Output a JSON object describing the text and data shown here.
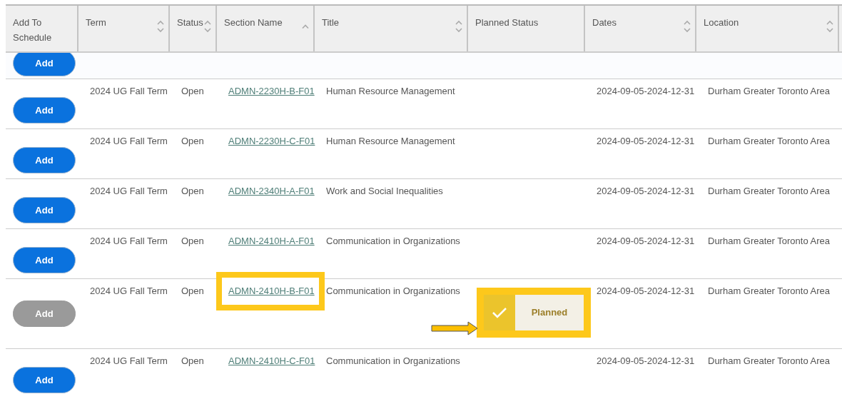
{
  "columns": [
    {
      "label": "Add To Schedule",
      "sort_up": false,
      "sort_down": false
    },
    {
      "label": "Term",
      "sort_up": true,
      "sort_down": true
    },
    {
      "label": "Status",
      "sort_up": true,
      "sort_down": true
    },
    {
      "label": "Section Name",
      "sort_up": true,
      "sort_down": false
    },
    {
      "label": "Title",
      "sort_up": true,
      "sort_down": true
    },
    {
      "label": "Planned Status",
      "sort_up": false,
      "sort_down": false
    },
    {
      "label": "Dates",
      "sort_up": true,
      "sort_down": true
    },
    {
      "label": "Location",
      "sort_up": true,
      "sort_down": true
    }
  ],
  "rows": [
    {
      "kind": "partial",
      "add_label": "Add",
      "add_disabled": false
    },
    {
      "kind": "full",
      "add_label": "Add",
      "add_disabled": false,
      "term": "2024 UG Fall Term",
      "status": "Open",
      "section": "ADMN-2230H-B-F01",
      "section_highlighted": false,
      "title": "Human Resource Management",
      "dates": "2024-09-05-2024-12-31",
      "location": "Durham Greater Toronto Area"
    },
    {
      "kind": "full",
      "add_label": "Add",
      "add_disabled": false,
      "term": "2024 UG Fall Term",
      "status": "Open",
      "section": "ADMN-2230H-C-F01",
      "section_highlighted": false,
      "title": "Human Resource Management",
      "dates": "2024-09-05-2024-12-31",
      "location": "Durham Greater Toronto Area"
    },
    {
      "kind": "full",
      "add_label": "Add",
      "add_disabled": false,
      "term": "2024 UG Fall Term",
      "status": "Open",
      "section": "ADMN-2340H-A-F01",
      "section_highlighted": false,
      "title": "Work and Social Inequalities",
      "dates": "2024-09-05-2024-12-31",
      "location": "Durham Greater Toronto Area"
    },
    {
      "kind": "full",
      "add_label": "Add",
      "add_disabled": false,
      "term": "2024 UG Fall Term",
      "status": "Open",
      "section": "ADMN-2410H-A-F01",
      "section_highlighted": false,
      "title": "Communication in Organizations",
      "dates": "2024-09-05-2024-12-31",
      "location": "Durham Greater Toronto Area"
    },
    {
      "kind": "full",
      "add_label": "Add",
      "add_disabled": true,
      "term": "2024 UG Fall Term",
      "status": "Open",
      "section": "ADMN-2410H-B-F01",
      "section_highlighted": true,
      "title": "Communication in Organizations",
      "planned_status": "Planned",
      "planned_highlighted": true,
      "dates": "2024-09-05-2024-12-31",
      "location": "Durham Greater Toronto Area"
    },
    {
      "kind": "full",
      "add_label": "Add",
      "add_disabled": false,
      "term": "2024 UG Fall Term",
      "status": "Open",
      "section": "ADMN-2410H-C-F01",
      "section_highlighted": false,
      "title": "Communication in Organizations",
      "dates": "2024-09-05-2024-12-31",
      "location": "Durham Greater Toronto Area"
    }
  ]
}
